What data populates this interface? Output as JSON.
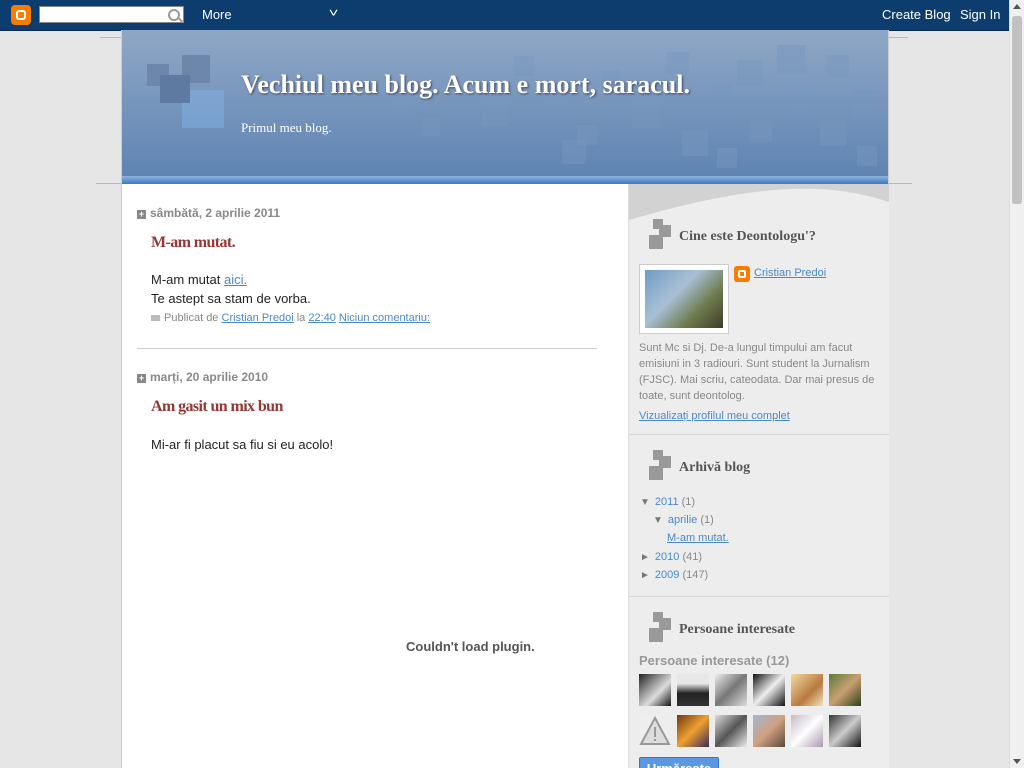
{
  "navbar": {
    "search_placeholder": "",
    "more_label": "More",
    "create_blog_label": "Create Blog",
    "sign_in_label": "Sign In"
  },
  "blog": {
    "title": "Vechiul meu blog. Acum e mort, saracul.",
    "description": "Primul meu blog."
  },
  "posts": [
    {
      "date": "sâmbătă, 2 aprilie 2011",
      "title": "M-am mutat.",
      "body_line1_text": "M-am mutat ",
      "body_line1_link": "aici.",
      "body_line2": "Te astept sa stam de vorba.",
      "footer_prefix": "Publicat de",
      "author": "Cristian Predoi",
      "time_prefix": "la",
      "time": "22:40",
      "comments": "Niciun comentariu:"
    },
    {
      "date": "marți, 20 aprilie 2010",
      "title": "Am gasit un mix bun",
      "body": "Mi-ar fi placut sa fiu si eu acolo!",
      "plugin_message": "Couldn't load plugin."
    }
  ],
  "sidebar": {
    "profile": {
      "title": "Cine este Deontologu'?",
      "name": "Cristian Predoi",
      "about": "Sunt Mc si Dj. De-a lungul timpului am facut emisiuni in 3 radiouri. Sunt student la Jurnalism (FJSC). Mai scriu, cateodata. Dar mai presus de toate, sunt deontolog.",
      "view_profile": "Vizualizați profilul meu complet"
    },
    "archive": {
      "title": "Arhivă blog",
      "items": [
        {
          "arrow": "▼",
          "label": "2011",
          "count": "(1)"
        },
        {
          "arrow": "▼",
          "label": "aprilie",
          "count": "(1)"
        },
        {
          "arrow": "",
          "label": "M-am mutat.",
          "count": ""
        },
        {
          "arrow": "►",
          "label": "2010",
          "count": "(41)"
        },
        {
          "arrow": "►",
          "label": "2009",
          "count": "(147)"
        }
      ]
    },
    "followers": {
      "title": "Persoane interesate",
      "label": "Persoane interesate (12)",
      "follow_button": "Urmărește"
    }
  },
  "colors": {
    "navbar": "#0d3d6e",
    "post_title": "#963737",
    "link": "#4a89c8",
    "header_blue": "#6f90bc"
  }
}
